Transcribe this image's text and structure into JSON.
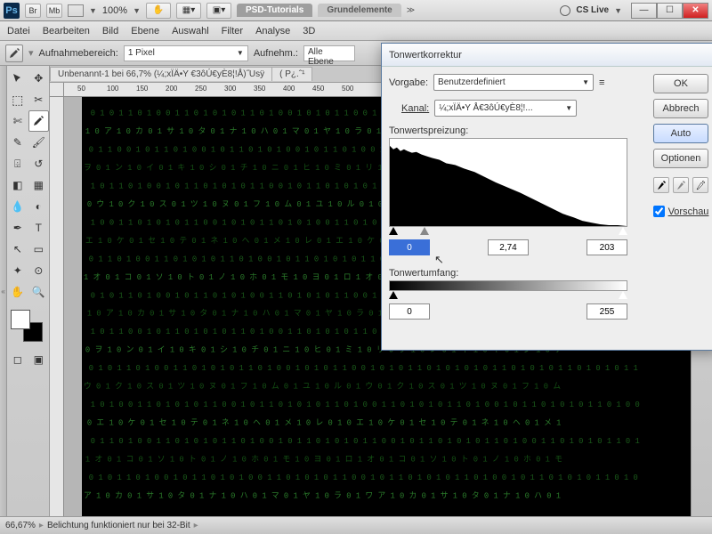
{
  "titlebar": {
    "zoom": "100%",
    "tab_active": "PSD-Tutorials",
    "tab_inactive": "Grundelemente",
    "cs_live": "CS Live"
  },
  "menu": [
    "Datei",
    "Bearbeiten",
    "Bild",
    "Ebene",
    "Auswahl",
    "Filter",
    "Analyse",
    "3D"
  ],
  "options": {
    "aufnahmebereich_lbl": "Aufnahmebereich:",
    "aufnahmebereich_val": "1 Pixel",
    "aufnehm_lbl": "Aufnehm.:",
    "alle_ebenen": "Alle Ebene"
  },
  "doc_tabs": {
    "tab1": "Unbenannt-1 bei 66,7% (¼;xÏÄ•Y €3ôÚ€yÈ8¦!Å)˝Usÿ",
    "tab2": "( P¿.ˆ¹"
  },
  "ruler": [
    "50",
    "100",
    "150",
    "200",
    "250",
    "300",
    "350",
    "400",
    "450",
    "500"
  ],
  "dialog": {
    "title": "Tonwertkorrektur",
    "vorgabe_lbl": "Vorgabe:",
    "vorgabe_val": "Benutzerdefiniert",
    "kanal_lbl": "Kanal:",
    "kanal_val": "¼;xÏÄ•Y Å€3ôÚ€yÈ8¦!...",
    "tonwertspreizung_lbl": "Tonwertspreizung:",
    "input_black": "0",
    "input_gamma": "2,74",
    "input_white": "203",
    "tonwertumfang_lbl": "Tonwertumfang:",
    "output_black": "0",
    "output_white": "255",
    "ok": "OK",
    "abbrechen": "Abbrech",
    "auto": "Auto",
    "optionen": "Optionen",
    "vorschau": "Vorschau"
  },
  "status": {
    "zoom": "66,67%",
    "msg": "Belichtung funktioniert nur bei 32-Bit"
  }
}
